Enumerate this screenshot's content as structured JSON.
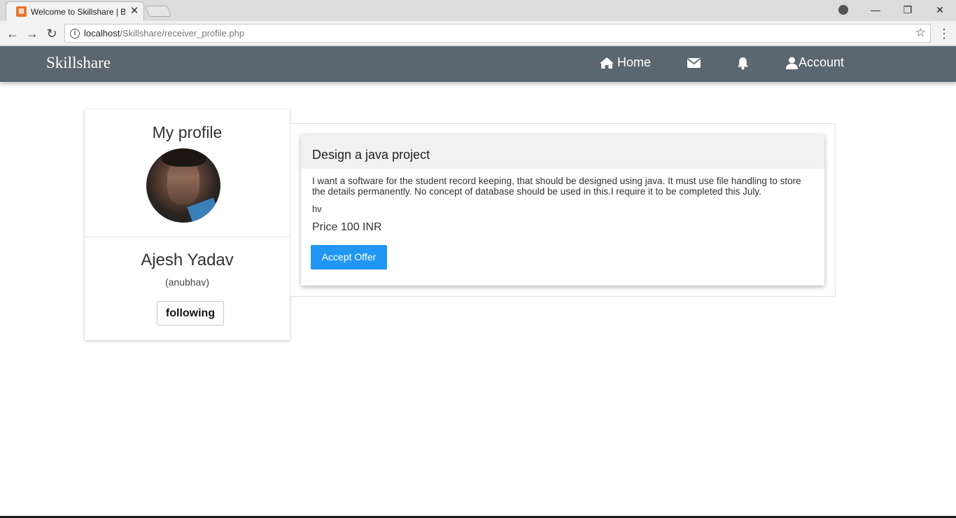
{
  "browser": {
    "tab_title": "Welcome to Skillshare | B",
    "tab_close": "✕",
    "url_host": "localhost",
    "url_path": "/Skillshare/receiver_profile.php"
  },
  "site": {
    "brand": "Skillshare",
    "nav": {
      "home": "Home",
      "account": "Account"
    }
  },
  "profile": {
    "heading": "My profile",
    "name": "Ajesh Yadav",
    "username": "(anubhav)",
    "follow_label": "following"
  },
  "offer": {
    "title": "Design a java project",
    "description": "I want a software for the student record keeping, that should be designed using java. It must use file handling to store the details permanently. No concept of database should be used in this.I require it to be completed this July.",
    "note": "hv",
    "price": "Price 100 INR",
    "accept_label": "Accept Offer"
  },
  "colors": {
    "navbar": "#5a6770",
    "accent": "#2196f3"
  }
}
